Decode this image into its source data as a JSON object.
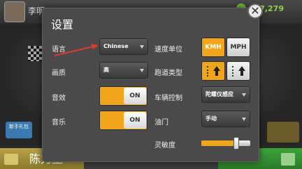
{
  "background": {
    "player_name": "李明",
    "coins": "77,279",
    "gift_label": "新手礼包",
    "bottom_button": "陈力堡"
  },
  "dialog": {
    "title": "设置",
    "close_glyph": "✕"
  },
  "settings": {
    "language": {
      "label": "语言",
      "value": "Chinese"
    },
    "quality": {
      "label": "画质",
      "value": "高"
    },
    "sound": {
      "label": "音效",
      "state": "ON"
    },
    "music": {
      "label": "音乐",
      "state": "ON"
    },
    "speed_unit": {
      "label": "速度单位",
      "options": [
        "KMH",
        "MPH"
      ],
      "selected": "KMH"
    },
    "track_type": {
      "label": "跑道类型"
    },
    "vehicle_control": {
      "label": "车辆控制",
      "value": "陀螺仪感应"
    },
    "throttle": {
      "label": "油门",
      "value": "手动"
    },
    "sensitivity": {
      "label": "灵敏度",
      "level_percent": 72
    }
  },
  "colors": {
    "accent": "#f1a51c",
    "annotation_arrow": "#e03a2a"
  }
}
